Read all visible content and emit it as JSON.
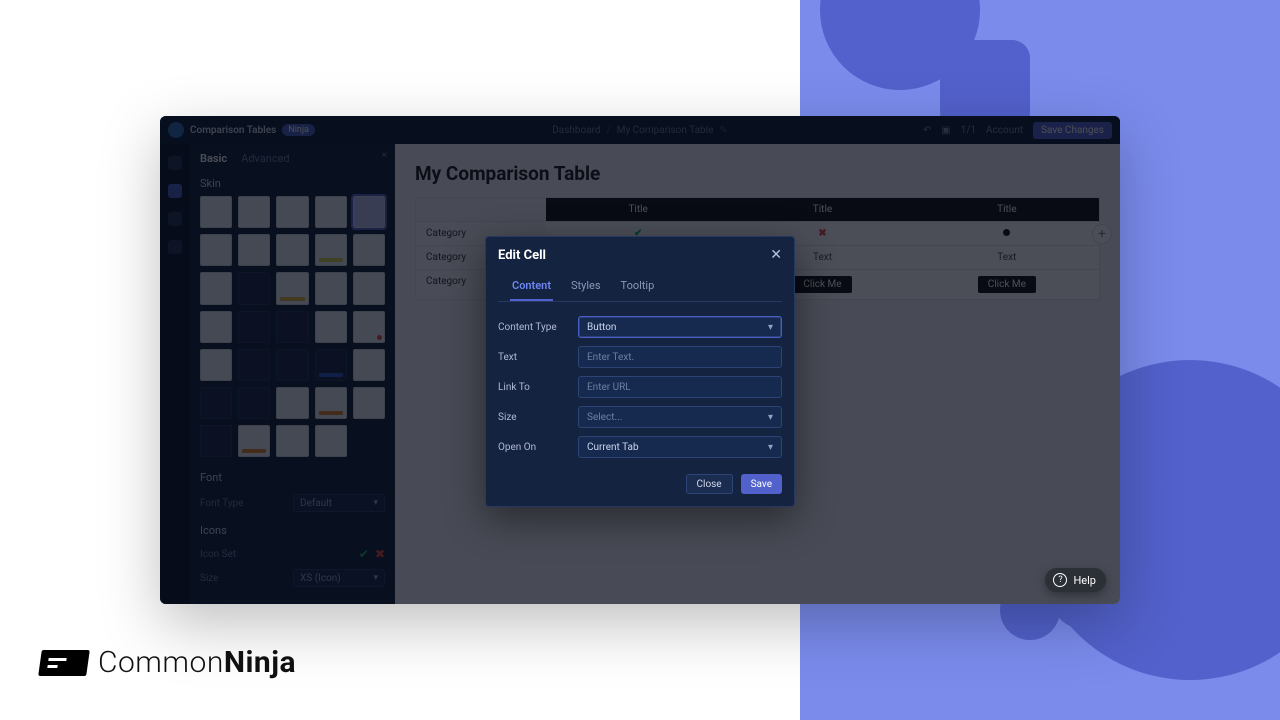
{
  "brand": {
    "name": "CommonNinja",
    "word_a": "Common",
    "word_b": "Ninja"
  },
  "topbar": {
    "product": "Comparison Tables",
    "badge": "Ninja",
    "crumb_root": "Dashboard",
    "crumb_current": "My Comparison Table",
    "counter": "1/1",
    "account": "Account",
    "save": "Save Changes"
  },
  "sidepanel": {
    "tab_basic": "Basic",
    "tab_advanced": "Advanced",
    "section_skin": "Skin",
    "section_font": "Font",
    "font_label": "Font Type",
    "font_value": "Default",
    "section_icons": "Icons",
    "icons_label": "Icon Set",
    "size_label": "Size",
    "size_value": "XS (Icon)"
  },
  "canvas": {
    "page_title": "My Comparison Table",
    "col_headers": [
      "Title",
      "Title",
      "Title"
    ],
    "row_labels": [
      "Category",
      "Category",
      "Category"
    ],
    "text_cell": "Text",
    "button_cell": "Click Me"
  },
  "modal": {
    "title": "Edit Cell",
    "tabs": {
      "content": "Content",
      "styles": "Styles",
      "tooltip": "Tooltip"
    },
    "fields": {
      "content_type": {
        "label": "Content Type",
        "value": "Button"
      },
      "text": {
        "label": "Text",
        "placeholder": "Enter Text."
      },
      "link_to": {
        "label": "Link To",
        "placeholder": "Enter URL"
      },
      "size": {
        "label": "Size",
        "value": "Select..."
      },
      "open_on": {
        "label": "Open On",
        "value": "Current Tab"
      }
    },
    "buttons": {
      "close": "Close",
      "save": "Save"
    }
  },
  "help": "Help"
}
